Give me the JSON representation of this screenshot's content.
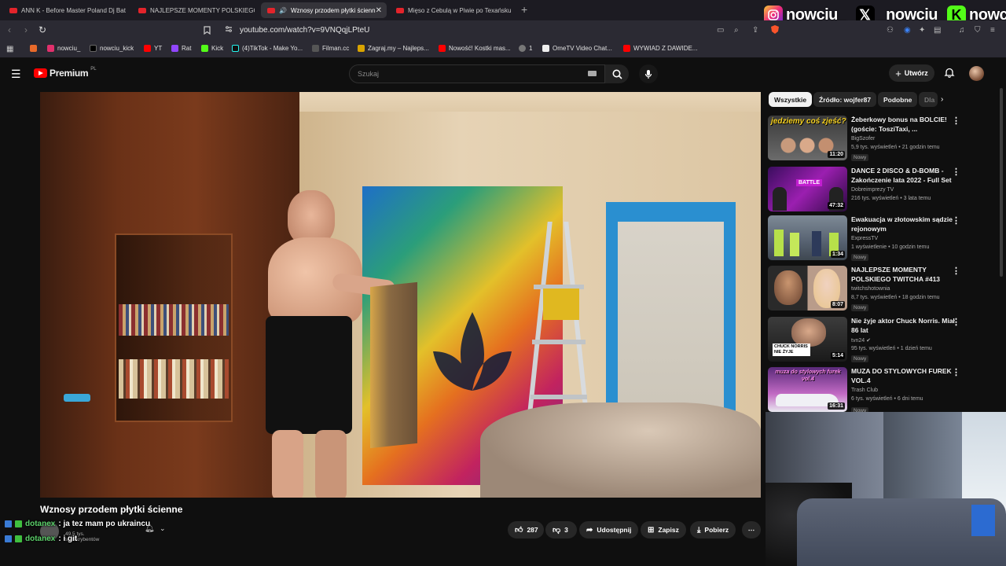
{
  "browser": {
    "tabs": [
      {
        "label": "ANN K - Before Master Poland Dj Bat"
      },
      {
        "label": "NAJLEPSZE MOMENTY POLSKIEGO T"
      },
      {
        "label": "Wznosy przodem płytki ścienn"
      },
      {
        "label": "Mięso z Cebulą w Piwie po Texańsku"
      }
    ],
    "url": "youtube.com/watch?v=9VNQqjLPteU",
    "bookmarks": [
      {
        "label": "nowciu_",
        "color": "#e1306c"
      },
      {
        "label": "nowciu_kick",
        "color": "#000000"
      },
      {
        "label": "YT",
        "color": "#ff0000"
      },
      {
        "label": "Rat",
        "color": "#9146ff"
      },
      {
        "label": "Kick",
        "color": "#53fc18"
      },
      {
        "label": "(4)TikTok - Make Yo...",
        "color": "#111111"
      },
      {
        "label": "Filman.cc",
        "color": "#444444"
      },
      {
        "label": "Zagraj.my – Najleps...",
        "color": "#d9a400"
      },
      {
        "label": "Nowość! Kostki mas...",
        "color": "#ff0000"
      },
      {
        "label": "1",
        "color": "#777777"
      },
      {
        "label": "OmeTV Video Chat...",
        "color": "#eeeeee"
      },
      {
        "label": "WYWIAD Z DAWIDE...",
        "color": "#ff0000"
      }
    ]
  },
  "overlay": {
    "socials": [
      {
        "icon": "instagram-icon",
        "handle": "nowciu_"
      },
      {
        "icon": "x-icon",
        "handle": "_nowciu"
      },
      {
        "icon": "kick-icon",
        "handle": "nowciu"
      }
    ],
    "chat": [
      {
        "user": "dotanex",
        "message": "ja tez mam po ukraincu"
      },
      {
        "user": "dotanex",
        "message": "i git"
      }
    ]
  },
  "youtube": {
    "logo_text": "Premium",
    "region": "PL",
    "search_placeholder": "Szukaj",
    "create_label": "Utwórz",
    "video": {
      "title": "Wznosy przodem płytki ścienne",
      "subscribers": "49,5 tys. subskrybentów",
      "likes": "287",
      "dislikes": "3",
      "share_label": "Udostępnij",
      "save_label": "Zapisz",
      "download_label": "Pobierz"
    },
    "chips": [
      {
        "label": "Wszystkie",
        "active": true
      },
      {
        "label": "Źródło: wojfer87",
        "active": false
      },
      {
        "label": "Podobne",
        "active": false
      },
      {
        "label": "Dla",
        "active": false
      }
    ],
    "recommendations": [
      {
        "title": "Żeberkowy bonus na BOLCIE! (goście: TosziTaxi, ...",
        "channel": "BigSzofer",
        "meta": "5,9 tys. wyświetleń • 21 godzin temu",
        "badge": "Nowy",
        "duration": "11:20",
        "thumb_text": "jedziemy coś zjeść?"
      },
      {
        "title": "DANCE 2 DISCO & D-BOMB - Zakończenie lata 2022 - Full Set",
        "channel": "Dobreimprezy TV",
        "meta": "216 tys. wyświetleń • 3 lata temu",
        "badge": "",
        "duration": "47:32",
        "thumb_text": "BATTLE"
      },
      {
        "title": "Ewakuacja w złotowskim sądzie rejonowym",
        "channel": "ExpressTV",
        "meta": "1 wyświetlenie • 10 godzin temu",
        "badge": "Nowy",
        "duration": "1:34",
        "thumb_text": ""
      },
      {
        "title": "NAJLEPSZE MOMENTY POLSKIEGO TWITCHA #413",
        "channel": "twitchshotownia",
        "meta": "8,7 tys. wyświetleń • 18 godzin temu",
        "badge": "Nowy",
        "duration": "8:07",
        "thumb_text": ""
      },
      {
        "title": "Nie żyje aktor Chuck Norris. Miał 86 lat",
        "channel": "tvn24",
        "meta": "95 tys. wyświetleń • 1 dzień temu",
        "badge": "Nowy",
        "duration": "5:14",
        "thumb_text": "CHUCK NORRIS NIE ŻYJE"
      },
      {
        "title": "MUZA DO STYLOWYCH FUREK VOL.4",
        "channel": "Trash Club",
        "meta": "6 tys. wyświetleń • 6 dni temu",
        "badge": "Nowy",
        "duration": "16:31",
        "thumb_text": "muza do stylowych furek vol.4"
      }
    ]
  }
}
